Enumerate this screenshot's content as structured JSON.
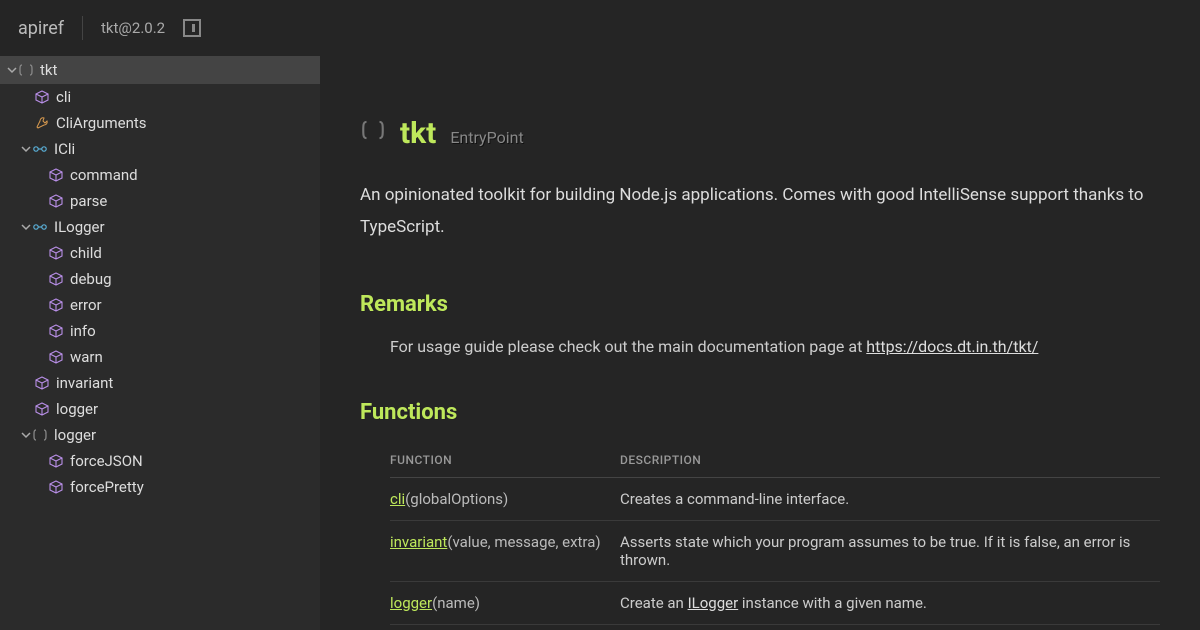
{
  "header": {
    "brand": "apiref",
    "package": "tkt@2.0.2"
  },
  "sidebar": {
    "root": {
      "label": "tkt",
      "icon": "namespace"
    },
    "items": [
      {
        "depth": 1,
        "icon": "cube",
        "label": "cli",
        "chev": false
      },
      {
        "depth": 1,
        "icon": "wrench",
        "label": "CliArguments",
        "chev": false
      },
      {
        "depth": 1,
        "icon": "interface",
        "label": "ICli",
        "chev": true
      },
      {
        "depth": 2,
        "icon": "cube",
        "label": "command",
        "chev": false
      },
      {
        "depth": 2,
        "icon": "cube",
        "label": "parse",
        "chev": false
      },
      {
        "depth": 1,
        "icon": "interface",
        "label": "ILogger",
        "chev": true
      },
      {
        "depth": 2,
        "icon": "cube",
        "label": "child",
        "chev": false
      },
      {
        "depth": 2,
        "icon": "cube",
        "label": "debug",
        "chev": false
      },
      {
        "depth": 2,
        "icon": "cube",
        "label": "error",
        "chev": false
      },
      {
        "depth": 2,
        "icon": "cube",
        "label": "info",
        "chev": false
      },
      {
        "depth": 2,
        "icon": "cube",
        "label": "warn",
        "chev": false
      },
      {
        "depth": 1,
        "icon": "cube",
        "label": "invariant",
        "chev": false
      },
      {
        "depth": 1,
        "icon": "cube",
        "label": "logger",
        "chev": false
      },
      {
        "depth": 1,
        "icon": "namespace",
        "label": "logger",
        "chev": true
      },
      {
        "depth": 2,
        "icon": "cube",
        "label": "forceJSON",
        "chev": false
      },
      {
        "depth": 2,
        "icon": "cube",
        "label": "forcePretty",
        "chev": false
      }
    ]
  },
  "page": {
    "title": "tkt",
    "badge": "EntryPoint",
    "summary": "An opinionated toolkit for building Node.js applications. Comes with good IntelliSense support thanks to TypeScript.",
    "remarks_h": "Remarks",
    "remarks_text": "For usage guide please check out the main documentation page at ",
    "remarks_link": "https://docs.dt.in.th/tkt/",
    "functions_h": "Functions",
    "table": {
      "col_fn": "FUNCTION",
      "col_desc": "DESCRIPTION",
      "rows": [
        {
          "name": "cli",
          "sig": "(globalOptions)",
          "desc": "Creates a command-line interface."
        },
        {
          "name": "invariant",
          "sig": "(value, message, extra)",
          "desc": "Asserts state which your program assumes to be true. If it is false, an error is thrown."
        },
        {
          "name": "logger",
          "sig": "(name)",
          "desc_pre": "Create an ",
          "desc_link": "ILogger",
          "desc_post": " instance with a given name."
        }
      ]
    }
  }
}
